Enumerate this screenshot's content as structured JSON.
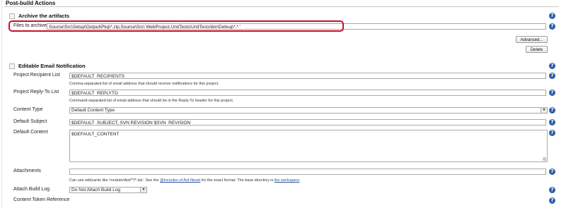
{
  "header": {
    "title": "Post-build Actions"
  },
  "archive": {
    "title": "Archive the artifacts",
    "files_label": "Files to archive",
    "files_value": "Source\\Src\\Setup\\Output\\Pkg\\*.zip,Source\\Src\\ WebProject.UnitTests\\UnitTests\\bin\\Debug\\*.* '",
    "advanced_label": "Advanced...",
    "delete_label": "Delete"
  },
  "email": {
    "title": "Editable Email Notification",
    "recipient_label": "Project Recipient List",
    "recipient_value": "$DEFAULT_RECIPIENTS",
    "recipient_hint": "Comma-separated list of email address that should receive notifications for this project.",
    "replyto_label": "Project Reply-To List",
    "replyto_value": "$DEFAULT_REPLYTO",
    "replyto_hint": "Command-separated list of email address that should be in the Reply-To header for this project.",
    "content_type_label": "Content Type",
    "content_type_value": "Default Content Type",
    "subject_label": "Default Subject",
    "subject_value": "$DEFAULT_SUBJECT, SVN REVISION $SVN_REVISION",
    "content_label": "Default Content",
    "content_value": "$DEFAULT_CONTENT",
    "attachments_label": "Attachments",
    "attachments_value": "",
    "attachments_hint_prefix": "Can use wildcards like 'module/dist/**/*.zip'. See the ",
    "attachments_hint_link1": "@includes of Ant fileset",
    "attachments_hint_mid": " for the exact format. The base directory is ",
    "attachments_hint_link2": "the workspace",
    "attachments_hint_suffix": ".",
    "build_log_label": "Attach Build Log",
    "build_log_value": "Do Not Attach Build Log",
    "token_ref_label": "Content Token Reference"
  },
  "help_glyph": "?",
  "dropdown_arrow": "▼",
  "colors": {
    "help": "#2d5fa8",
    "highlight": "#c8102e",
    "link": "#2a4ea8"
  }
}
